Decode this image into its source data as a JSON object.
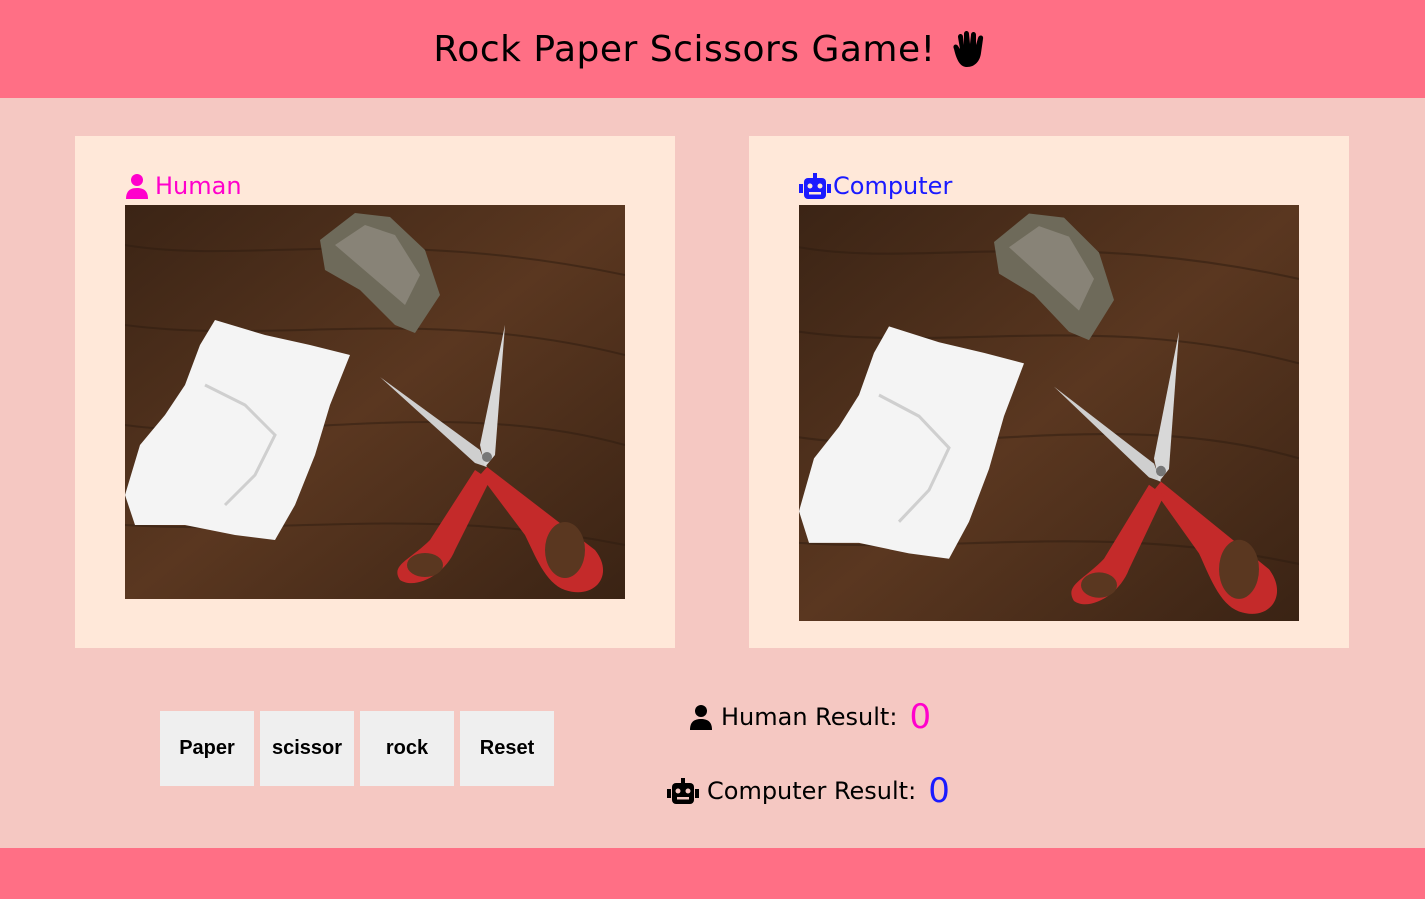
{
  "header": {
    "title": "Rock Paper Scissors Game!",
    "icon": "raised-hand-icon"
  },
  "human_panel": {
    "label": "Human",
    "icon": "user-icon",
    "color": "#ff00cc"
  },
  "computer_panel": {
    "label": "Computer",
    "icon": "robot-icon",
    "color": "#1a1aff"
  },
  "photo": {
    "icon": "rock-paper-scissors-photo"
  },
  "buttons": [
    {
      "label": "Paper"
    },
    {
      "label": "scissor"
    },
    {
      "label": "rock"
    },
    {
      "label": "Reset"
    }
  ],
  "results": {
    "human": {
      "label": "Human Result:",
      "score": "0"
    },
    "computer": {
      "label": "Computer Result:",
      "score": "0"
    }
  },
  "colors": {
    "header": "#ff6f85",
    "background": "#f5c8c2",
    "panel": "#ffe8d9",
    "button": "#efefef"
  }
}
